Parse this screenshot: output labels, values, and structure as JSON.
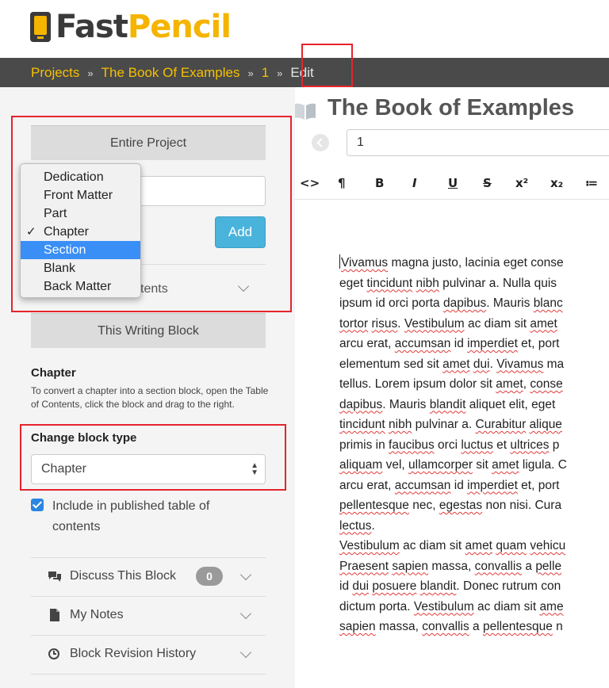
{
  "header": {
    "logo_fast": "Fast",
    "logo_pencil": "Pencil",
    "breadcrumbs": [
      "Projects",
      "The Book Of Examples",
      "1"
    ],
    "breadcrumb_separator": "»",
    "current": "Edit"
  },
  "sidebar": {
    "entire_project": "Entire Project",
    "add_button": "Add",
    "toc_label_partial": "tents",
    "dropdown": {
      "items": [
        "Dedication",
        "Front Matter",
        "Part",
        "Chapter",
        "Section",
        "Blank",
        "Back Matter"
      ],
      "checked": "Chapter",
      "highlighted": "Section",
      "check_mark": "✓"
    },
    "this_writing_block": "This Writing Block",
    "chapter_heading": "Chapter",
    "chapter_description": "To convert a chapter into a section block, open the Table of Contents, click the block and drag to the right.",
    "change_block_type_label": "Change block type",
    "block_type_value": "Chapter",
    "include_toc_label": "Include in published table of contents",
    "discuss_label": "Discuss This Block",
    "discuss_count": "0",
    "notes_label": "My Notes",
    "revision_label": "Block Revision History"
  },
  "main": {
    "book_title": "The Book of Examples",
    "page_value": "1",
    "toolbar": [
      "<>",
      "¶",
      "B",
      "I",
      "U",
      "S",
      "x²",
      "x₂",
      "≔"
    ],
    "text_lines": [
      [
        {
          "t": "Vivamus",
          "s": true
        },
        {
          "t": " magna justo, lacinia eget conse"
        }
      ],
      [
        {
          "t": "eget "
        },
        {
          "t": "tincidunt",
          "s": true
        },
        {
          "t": " "
        },
        {
          "t": "nibh",
          "s": true
        },
        {
          "t": " pulvinar a. Nulla quis "
        }
      ],
      [
        {
          "t": "ipsum id orci porta "
        },
        {
          "t": "dapibus",
          "s": true
        },
        {
          "t": ". Mauris "
        },
        {
          "t": "blanc",
          "s": true
        }
      ],
      [
        {
          "t": "tortor",
          "s": true
        },
        {
          "t": " "
        },
        {
          "t": "risus",
          "s": true
        },
        {
          "t": ". "
        },
        {
          "t": "Vestibulum",
          "s": true
        },
        {
          "t": " ac diam sit "
        },
        {
          "t": "amet",
          "s": true
        }
      ],
      [
        {
          "t": "arcu erat, "
        },
        {
          "t": "accumsan",
          "s": true
        },
        {
          "t": " id "
        },
        {
          "t": "imperdiet",
          "s": true
        },
        {
          "t": " et, port"
        }
      ],
      [
        {
          "t": "elementum sed sit "
        },
        {
          "t": "amet",
          "s": true
        },
        {
          "t": " "
        },
        {
          "t": "dui",
          "s": true
        },
        {
          "t": ". "
        },
        {
          "t": "Vivamus",
          "s": true
        },
        {
          "t": " ma"
        }
      ],
      [
        {
          "t": "tellus. Lorem ipsum dolor sit "
        },
        {
          "t": "amet",
          "s": true
        },
        {
          "t": ", "
        },
        {
          "t": "conse",
          "s": true
        }
      ],
      [
        {
          "t": "dapibus",
          "s": true
        },
        {
          "t": ". Mauris "
        },
        {
          "t": "blandit",
          "s": true
        },
        {
          "t": " aliquet elit, eget "
        }
      ],
      [
        {
          "t": "tincidunt",
          "s": true
        },
        {
          "t": " "
        },
        {
          "t": "nibh",
          "s": true
        },
        {
          "t": " pulvinar a. "
        },
        {
          "t": "Curabitur",
          "s": true
        },
        {
          "t": " "
        },
        {
          "t": "alique",
          "s": true
        }
      ],
      [
        {
          "t": "primis in "
        },
        {
          "t": "faucibus",
          "s": true
        },
        {
          "t": " orci "
        },
        {
          "t": "luctus",
          "s": true
        },
        {
          "t": " et "
        },
        {
          "t": "ultrices",
          "s": true
        },
        {
          "t": " p"
        }
      ],
      [
        {
          "t": "aliquam",
          "s": true
        },
        {
          "t": " vel, "
        },
        {
          "t": "ullamcorper",
          "s": true
        },
        {
          "t": " sit "
        },
        {
          "t": "amet",
          "s": true
        },
        {
          "t": " ligula. C"
        }
      ],
      [
        {
          "t": "arcu erat, "
        },
        {
          "t": "accumsan",
          "s": true
        },
        {
          "t": " id "
        },
        {
          "t": "imperdiet",
          "s": true
        },
        {
          "t": " et, port"
        }
      ],
      [
        {
          "t": "pellentesque",
          "s": true
        },
        {
          "t": " nec, "
        },
        {
          "t": "egestas",
          "s": true
        },
        {
          "t": " non nisi. Cura"
        }
      ],
      [
        {
          "t": "lectus",
          "s": true
        },
        {
          "t": "."
        }
      ],
      [
        {
          "t": "Vestibulum",
          "s": true
        },
        {
          "t": " ac diam sit "
        },
        {
          "t": "amet",
          "s": true
        },
        {
          "t": " "
        },
        {
          "t": "quam",
          "s": true
        },
        {
          "t": " "
        },
        {
          "t": "vehicu",
          "s": true
        }
      ],
      [
        {
          "t": "Praesent",
          "s": true
        },
        {
          "t": " "
        },
        {
          "t": "sapien",
          "s": true
        },
        {
          "t": " massa, "
        },
        {
          "t": "convallis",
          "s": true
        },
        {
          "t": " a "
        },
        {
          "t": "pelle",
          "s": true
        }
      ],
      [
        {
          "t": "id "
        },
        {
          "t": "dui",
          "s": true
        },
        {
          "t": " "
        },
        {
          "t": "posuere",
          "s": true
        },
        {
          "t": " "
        },
        {
          "t": "blandit",
          "s": true
        },
        {
          "t": ". Donec rutrum con"
        }
      ],
      [
        {
          "t": "dictum porta. "
        },
        {
          "t": "Vestibulum",
          "s": true
        },
        {
          "t": " ac diam sit "
        },
        {
          "t": "ame",
          "s": true
        }
      ],
      [
        {
          "t": "sapien",
          "s": true
        },
        {
          "t": " massa, "
        },
        {
          "t": "convallis",
          "s": true
        },
        {
          "t": " a "
        },
        {
          "t": "pellentesque",
          "s": true
        },
        {
          "t": " n"
        }
      ]
    ]
  },
  "colors": {
    "accent_yellow": "#f5b400",
    "breadcrumb_bar": "#4a4a4a",
    "highlight_red": "#e5242c",
    "add_button": "#4ab3dc",
    "selected_item": "#3a8ff7"
  }
}
